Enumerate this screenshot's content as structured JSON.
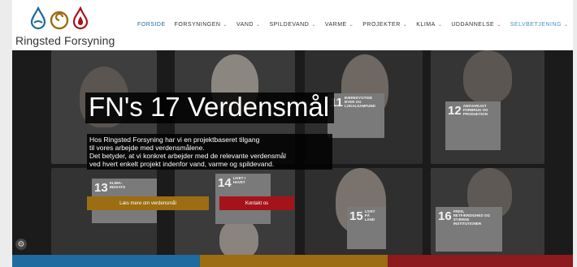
{
  "logo": {
    "text": "Ringsted Forsyning"
  },
  "nav": {
    "items": [
      {
        "label": "FORSIDE",
        "dropdown": false,
        "style": "active"
      },
      {
        "label": "FORSYNINGEN",
        "dropdown": true,
        "style": ""
      },
      {
        "label": "VAND",
        "dropdown": true,
        "style": ""
      },
      {
        "label": "SPILDEVAND",
        "dropdown": true,
        "style": ""
      },
      {
        "label": "VARME",
        "dropdown": true,
        "style": ""
      },
      {
        "label": "PROJEKTER",
        "dropdown": true,
        "style": ""
      },
      {
        "label": "KLIMA",
        "dropdown": true,
        "style": ""
      },
      {
        "label": "UDDANNELSE",
        "dropdown": true,
        "style": ""
      },
      {
        "label": "SELVBETJENING",
        "dropdown": true,
        "style": "highlight"
      }
    ],
    "chevron": "⌄"
  },
  "hero": {
    "title": "FN's 17 Verdensmål",
    "description_lines": [
      "Hos Ringsted Forsyning har vi en projektbaseret tilgang",
      "til vores arbejde med verdensmålene.",
      "Det betyder, at vi konkret arbejder med de relevante verdensmål",
      "ved hvert enkelt projekt indenfor vand, varme og spildevand."
    ],
    "sdg_cards": [
      {
        "num": "11",
        "text": "BÆREDYGTIGE BYER OG LOKALSAMFUND"
      },
      {
        "num": "12",
        "text": "ANSVARLIGT FORBRUG OG PRODUKTION"
      },
      {
        "num": "13",
        "text": "KLIMA-INDSATS"
      },
      {
        "num": "14",
        "text": "LIVET I HAVET"
      },
      {
        "num": "15",
        "text": "LIVET PÅ LAND"
      },
      {
        "num": "16",
        "text": "FRED, RETFÆRDIGHED OG STÆRKE INSTITUTIONER"
      }
    ],
    "buttons": {
      "learn_more": "Læs mere om verdensmål",
      "contact": "Kontakt os"
    }
  },
  "colors": {
    "blue": "#1f6a9e",
    "gold": "#9c6d12",
    "red": "#a5131a"
  }
}
